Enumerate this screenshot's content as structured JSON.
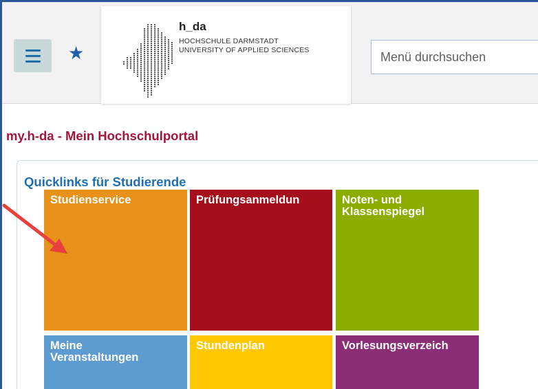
{
  "header": {
    "logo": {
      "title": "h_da",
      "line1": "HOCHSCHULE DARMSTADT",
      "line2": "UNIVERSITY OF APPLIED SCIENCES"
    },
    "search": {
      "placeholder": "Menü durchsuchen"
    },
    "icons": {
      "menu": "hamburger-menu-icon",
      "favorites": "star-icon"
    },
    "accent": "#2b5797"
  },
  "main": {
    "portal_title": "my.h-da - Mein Hochschulportal",
    "quicklinks": {
      "title": "Quicklinks für Studierende",
      "tiles": [
        {
          "label": "Studienservice",
          "color": "#e8911b"
        },
        {
          "label": "Prüfungsanmeldun",
          "color": "#a50f1c"
        },
        {
          "label": "Noten- und\nKlassenspiegel",
          "color": "#8bad00"
        },
        {
          "label": "Meine\nVeranstaltungen",
          "color": "#5e9bd1"
        },
        {
          "label": "Stundenplan",
          "color": "#ffc800"
        },
        {
          "label": "Vorlesungsverzeich",
          "color": "#8c2d78"
        }
      ]
    }
  },
  "annotation": {
    "arrow_color": "#e8403c"
  }
}
